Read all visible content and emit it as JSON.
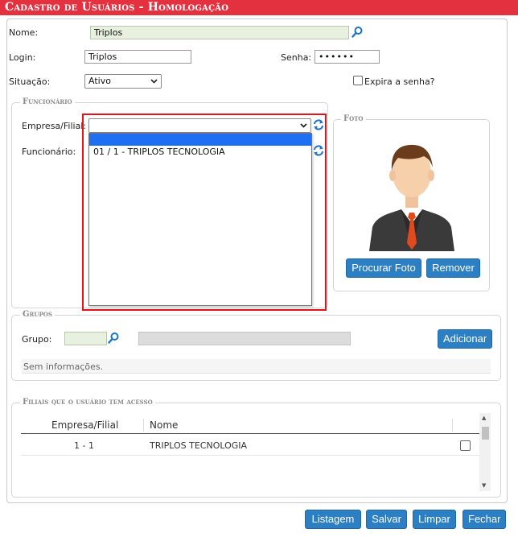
{
  "window": {
    "title": "Cadastro de Usuários  - Homologação"
  },
  "form": {
    "nome_label": "Nome:",
    "nome_value": "Triplos",
    "login_label": "Login:",
    "login_value": "Triplos",
    "senha_label": "Senha:",
    "senha_value": "••••••",
    "situacao_label": "Situação:",
    "situacao_value": "Ativo",
    "expira_label": "Expira a senha?"
  },
  "funcionario": {
    "legend": "Funcionário",
    "empresa_label": "Empresa/Filial:",
    "empresa_value": "",
    "funcionario_label": "Funcionário:",
    "dropdown_options": [
      "01 / 1 - TRIPLOS TECNOLOGIA"
    ]
  },
  "foto": {
    "legend": "Foto",
    "procurar_label": "Procurar Foto",
    "remover_label": "Remover"
  },
  "grupos": {
    "legend": "Grupos",
    "grupo_label": "Grupo:",
    "adicionar_label": "Adicionar",
    "empty_text": "Sem informações."
  },
  "filiais": {
    "legend": "Filiais que o usuário tem acesso",
    "columns": [
      "Empresa/Filial",
      "Nome"
    ],
    "rows": [
      {
        "empresa_filial": "1 - 1",
        "nome": "TRIPLOS TECNOLOGIA"
      }
    ]
  },
  "footer": {
    "listagem_label": "Listagem",
    "salvar_label": "Salvar",
    "limpar_label": "Limpar",
    "fechar_label": "Fechar"
  },
  "icons": {
    "search": "search-icon",
    "refresh": "refresh-icon",
    "chevron": "chevron-down-icon",
    "avatar": "avatar-placeholder"
  },
  "colors": {
    "title_bar": "#e3313f",
    "button": "#2b7fc2",
    "dropdown_highlight": "#1e6ff2",
    "callout": "#e3131d"
  }
}
